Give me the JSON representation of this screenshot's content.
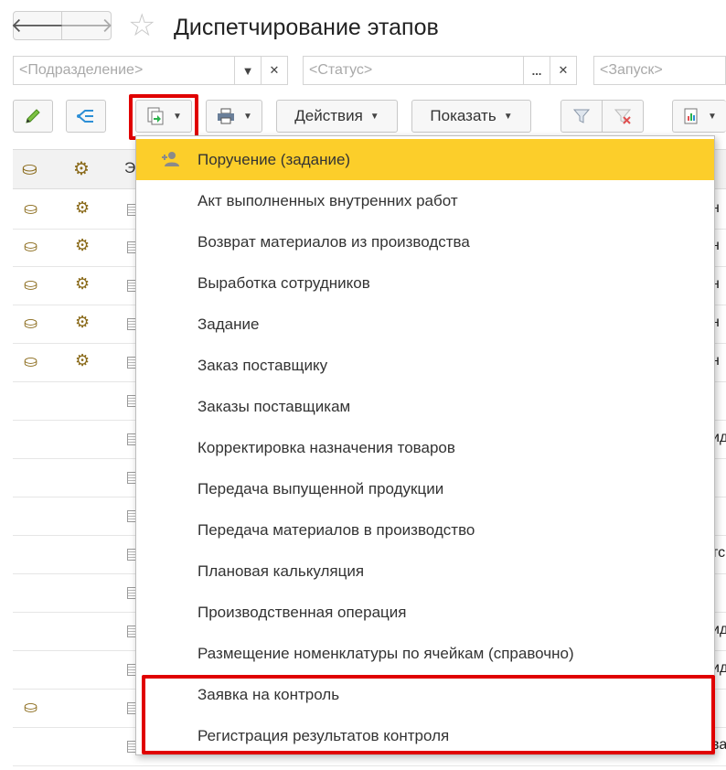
{
  "header": {
    "title": "Диспетчирование этапов",
    "back_icon": "arrow-left-icon",
    "forward_icon": "arrow-right-icon",
    "favorite_icon": "star-icon"
  },
  "filters": {
    "division": {
      "placeholder": "<Подразделение>"
    },
    "status": {
      "placeholder": "<Статус>"
    },
    "launch": {
      "placeholder": "<Запуск>"
    }
  },
  "toolbar": {
    "actions_label": "Действия",
    "show_label": "Показать",
    "icons": [
      "edit-pencil-icon",
      "structure-icon",
      "create-based-on-icon",
      "print-icon",
      "filter-icon",
      "clear-filter-icon",
      "report-icon"
    ]
  },
  "table": {
    "header_partial": "Э",
    "row_tails": [
      "н",
      "н",
      "н",
      "н",
      "н",
      "",
      "ид",
      "",
      "",
      "тс",
      "",
      "ид",
      "ид",
      "",
      "ва",
      ""
    ]
  },
  "menu": {
    "items": [
      "Поручение (задание)",
      "Акт выполненных внутренних работ",
      "Возврат материалов из производства",
      "Выработка сотрудников",
      "Задание",
      "Заказ поставщику",
      "Заказы поставщикам",
      "Корректировка назначения товаров",
      "Передача выпущенной продукции",
      "Передача материалов в производство",
      "Плановая калькуляция",
      "Производственная операция",
      "Размещение номенклатуры по ячейкам (справочно)",
      "Заявка на контроль",
      "Регистрация результатов контроля"
    ],
    "active_index": 0
  },
  "colors": {
    "highlight": "#e00000",
    "active_item": "#fcce2a"
  }
}
